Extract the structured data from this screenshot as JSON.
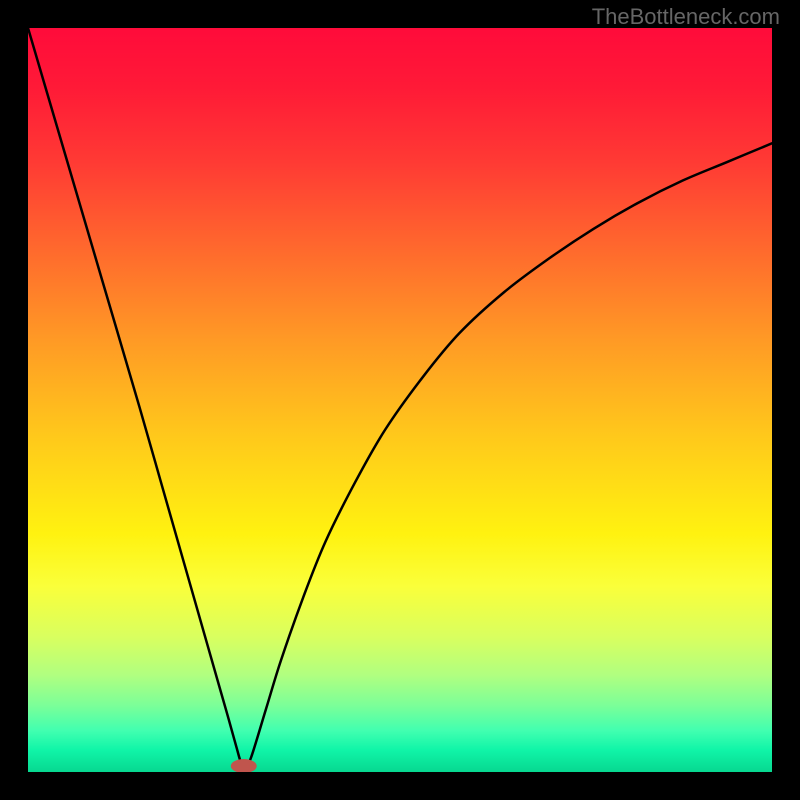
{
  "watermark": "TheBottleneck.com",
  "chart_data": {
    "type": "line",
    "title": "",
    "xlabel": "",
    "ylabel": "",
    "xlim": [
      0,
      100
    ],
    "ylim": [
      0,
      100
    ],
    "series": [
      {
        "name": "curve",
        "x": [
          0,
          5,
          10,
          15,
          18,
          21,
          24,
          26,
          27,
          28,
          28.7,
          29.3,
          30,
          32,
          34,
          37,
          40,
          44,
          48,
          53,
          58,
          64,
          70,
          76,
          82,
          88,
          94,
          100
        ],
        "values": [
          100,
          83,
          66,
          49,
          38.5,
          28,
          17.5,
          10.5,
          7.0,
          3.4,
          1.1,
          1.0,
          2.0,
          8.5,
          15,
          23.5,
          31,
          39,
          46,
          53,
          59,
          64.5,
          69,
          73,
          76.5,
          79.5,
          82,
          84.5
        ]
      }
    ],
    "min_point": {
      "x": 29,
      "y": 0.8
    },
    "background_gradient": {
      "top": "#ff0b3a",
      "mid": "#ffd400",
      "bottom": "#07d890"
    },
    "grid": false,
    "legend": false
  }
}
